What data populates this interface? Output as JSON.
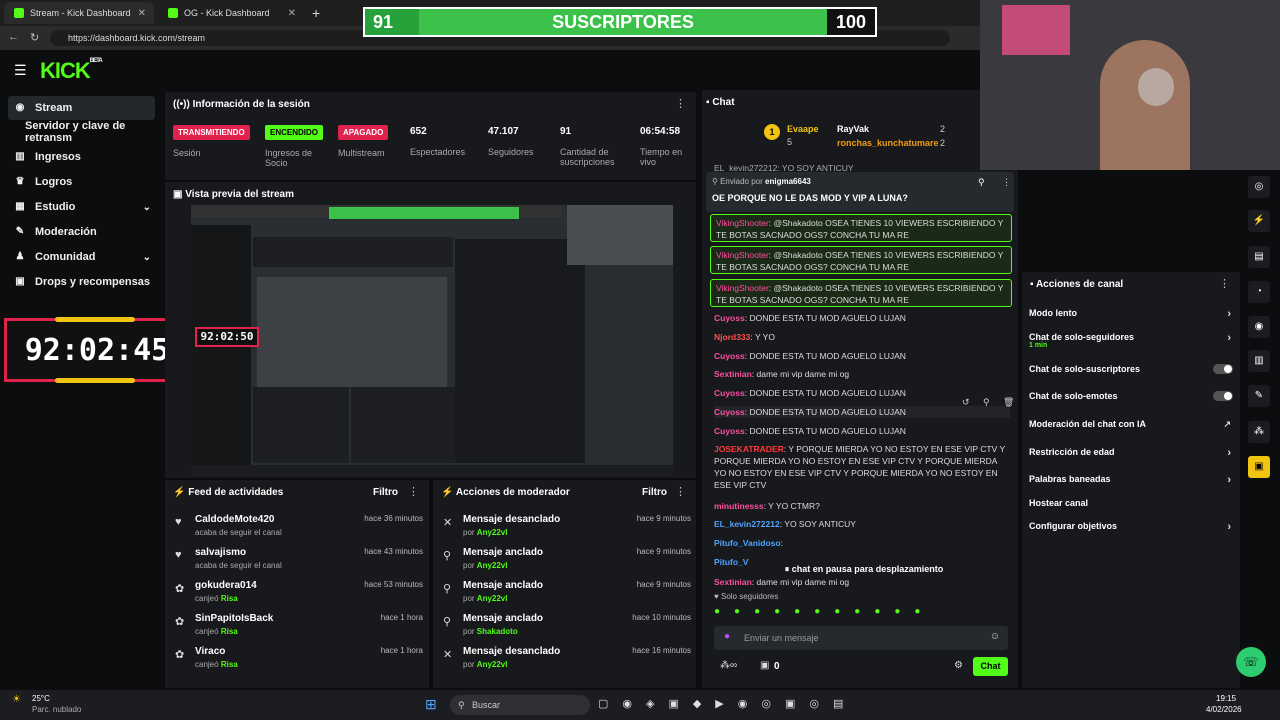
{
  "browser": {
    "tabs": [
      {
        "label": "Stream - Kick Dashboard"
      },
      {
        "label": "OG - Kick Dashboard"
      }
    ],
    "new_tab": "+",
    "url": "https://dashboard.kick.com/stream"
  },
  "overlay": {
    "sub_current": "91",
    "sub_label": "SUSCRIPTORES",
    "sub_goal": "100"
  },
  "header": {
    "logo": "KICK",
    "beta": "BETA"
  },
  "sidebar": {
    "items": [
      {
        "label": "Stream",
        "icon": "stream-icon"
      },
      {
        "label": "Servidor y clave de retransm"
      },
      {
        "label": "Ingresos",
        "icon": "chart-icon"
      },
      {
        "label": "Logros",
        "icon": "trophy-icon"
      },
      {
        "label": "Estudio",
        "icon": "studio-icon"
      },
      {
        "label": "Moderación",
        "icon": "wrench-icon"
      },
      {
        "label": "Comunidad",
        "icon": "community-icon"
      },
      {
        "label": "Drops y recompensas",
        "icon": "gift-icon"
      }
    ]
  },
  "timer": {
    "value": "92:02:45"
  },
  "session": {
    "title": "Información de la sesión",
    "stats": [
      {
        "badge": "TRANSMITIENDO",
        "label": "Sesión",
        "color": "#e0224d"
      },
      {
        "badge": "ENCENDIDO",
        "label": "Ingresos de Socio",
        "color": "#53fc18"
      },
      {
        "badge": "APAGADO",
        "label": "Multistream",
        "color": "#e0224d"
      },
      {
        "value": "652",
        "label": "Espectadores"
      },
      {
        "value": "47.107",
        "label": "Seguidores"
      },
      {
        "value": "91",
        "label": "Cantidad de suscripciones"
      },
      {
        "value": "06:54:58",
        "label": "Tiempo en vivo"
      }
    ]
  },
  "preview": {
    "title": "Vista previa del stream",
    "timer": "92:02:50"
  },
  "feed": {
    "title": "Feed de actividades",
    "filter": "Filtro",
    "rows": [
      {
        "name": "CaldodeMote420",
        "sub": "acaba de seguir el canal",
        "time": "hace 36 minutos",
        "icon": "heart-icon"
      },
      {
        "name": "salvajismo",
        "sub": "acaba de seguir el canal",
        "time": "hace 43 minutos",
        "icon": "heart-icon"
      },
      {
        "name": "gokudera014",
        "sub": "canjeó",
        "reward": "Risa",
        "time": "hace 53 minutos",
        "icon": "redeem-icon"
      },
      {
        "name": "SinPapitoIsBack",
        "sub": "canjeó",
        "reward": "Risa",
        "time": "hace 1 hora",
        "icon": "redeem-icon"
      },
      {
        "name": "Viraco",
        "sub": "canjeó",
        "reward": "Risa",
        "time": "hace 1 hora",
        "icon": "redeem-icon"
      }
    ]
  },
  "modactions": {
    "title": "Acciones de moderador",
    "filter": "Filtro",
    "rows": [
      {
        "name": "Mensaje desanclado",
        "by": "por",
        "user": "Any22vl",
        "time": "hace 9 minutos",
        "icon": "unpin-icon"
      },
      {
        "name": "Mensaje anclado",
        "by": "por",
        "user": "Any22vl",
        "time": "hace 9 minutos",
        "icon": "pin-icon"
      },
      {
        "name": "Mensaje anclado",
        "by": "por",
        "user": "Any22vl",
        "time": "hace 9 minutos",
        "icon": "pin-icon"
      },
      {
        "name": "Mensaje anclado",
        "by": "por",
        "user": "Shakadoto",
        "time": "hace 10 minutos",
        "icon": "pin-icon"
      },
      {
        "name": "Mensaje desanclado",
        "by": "por",
        "user": "Any22vl",
        "time": "hace 16 minutos",
        "icon": "unpin-icon"
      }
    ]
  },
  "chat": {
    "title": "Chat",
    "top_gifters": [
      {
        "rank": "1",
        "name": "Evaape",
        "count": "5"
      },
      {
        "name": "RayVak",
        "count": "2"
      },
      {
        "name": "ronchas_kunchatumare",
        "count": "2"
      }
    ],
    "cut_line": "EL_kevin272212: YO SOY ANTICUY",
    "pinned": {
      "by_label": "Enviado por",
      "by": "enigma6643",
      "text": "OE PORQUE NO LE DAS MOD Y VIP A LUNA?"
    },
    "messages": [
      {
        "user": "VikingShooter",
        "text": ": @Shakadoto OSEA TIENES 10 VIEWERS ESCRIBIENDO Y TE BOTAS SACNADO OGS? CONCHA TU MA RE",
        "color": "#ff4fa3"
      },
      {
        "user": "VikingShooter",
        "text": ": @Shakadoto OSEA TIENES 10 VIEWERS ESCRIBIENDO Y TE BOTAS SACNADO OGS? CONCHA TU MA RE",
        "color": "#ff4fa3"
      },
      {
        "user": "VikingShooter",
        "text": ": @Shakadoto OSEA TIENES 10 VIEWERS ESCRIBIENDO Y TE BOTAS SACNADO OGS? CONCHA TU MA RE",
        "color": "#ff4fa3"
      },
      {
        "user": "Cuyoss",
        "text": ": DONDE ESTA TU MOD AGUELO LUJAN",
        "color": "#ff4fa3"
      },
      {
        "user": "Njord333",
        "text": ": Y YO",
        "color": "#ff4f4f"
      },
      {
        "user": "Cuyoss",
        "text": ": DONDE ESTA TU MOD AGUELO LUJAN",
        "color": "#ff4fa3"
      },
      {
        "user": "Sextinian",
        "text": ": dame mi vip dame mi og",
        "color": "#ff4fa3"
      },
      {
        "user": "Cuyoss",
        "text": ": DONDE ESTA TU MOD AGUELO LUJAN",
        "color": "#ff4fa3"
      },
      {
        "user": "Cuyoss",
        "text": ": DONDE ESTA TU MOD AGUELO LUJAN",
        "color": "#ff4fa3"
      },
      {
        "user": "Cuyoss",
        "text": ": DONDE ESTA TU MOD AGUELO LUJAN",
        "color": "#ff4fa3"
      },
      {
        "user": "JOSEKATRADER",
        "text": ": Y PORQUE MIERDA YO NO ESTOY EN ESE VIP CTV Y PORQUE MIERDA YO NO ESTOY EN ESE VIP CTV Y PORQUE MIERDA YO NO ESTOY EN ESE VIP CTV Y PORQUE MIERDA YO NO ESTOY EN ESE VIP CTV",
        "color": "#ff3b3b"
      },
      {
        "user": "minutinesss",
        "text": ": Y YO CTMR?",
        "color": "#ff4fa3"
      },
      {
        "user": "EL_kevin272212",
        "text": ": YO SOY ANTICUY",
        "color": "#4fa3ff"
      },
      {
        "user": "Pitufo_Vanidoso",
        "text": ":",
        "color": "#4fa3ff"
      },
      {
        "user": "Pitufo_V",
        "text": "",
        "color": "#4fa3ff"
      },
      {
        "user": "Sextinian",
        "text": ": dame mi vip dame mi og",
        "color": "#ff4fa3"
      }
    ],
    "paused": "chat en pausa para desplazamiento",
    "followers_only": "Solo seguidores",
    "input_placeholder": "Enviar un mensaje",
    "points": "0",
    "send_label": "Chat"
  },
  "channel_actions": {
    "title": "Acciones de canal",
    "items": [
      {
        "label": "Modo lento",
        "type": "chevron"
      },
      {
        "label": "Chat de solo-seguidores",
        "sub": "1 min",
        "type": "chevron"
      },
      {
        "label": "Chat de solo-suscriptores",
        "type": "toggle"
      },
      {
        "label": "Chat de solo-emotes",
        "type": "toggle"
      },
      {
        "label": "Moderación del chat con IA",
        "type": "external"
      },
      {
        "label": "Restricción de edad",
        "type": "chevron"
      },
      {
        "label": "Palabras baneadas",
        "type": "chevron"
      },
      {
        "label": "Hostear canal",
        "type": "none"
      },
      {
        "label": "Configurar objetivos",
        "type": "chevron"
      }
    ]
  },
  "taskbar": {
    "weather_temp": "25°C",
    "weather_desc": "Parc. nublado",
    "search": "Buscar",
    "time": "19:15",
    "date": "4/02/2026"
  }
}
